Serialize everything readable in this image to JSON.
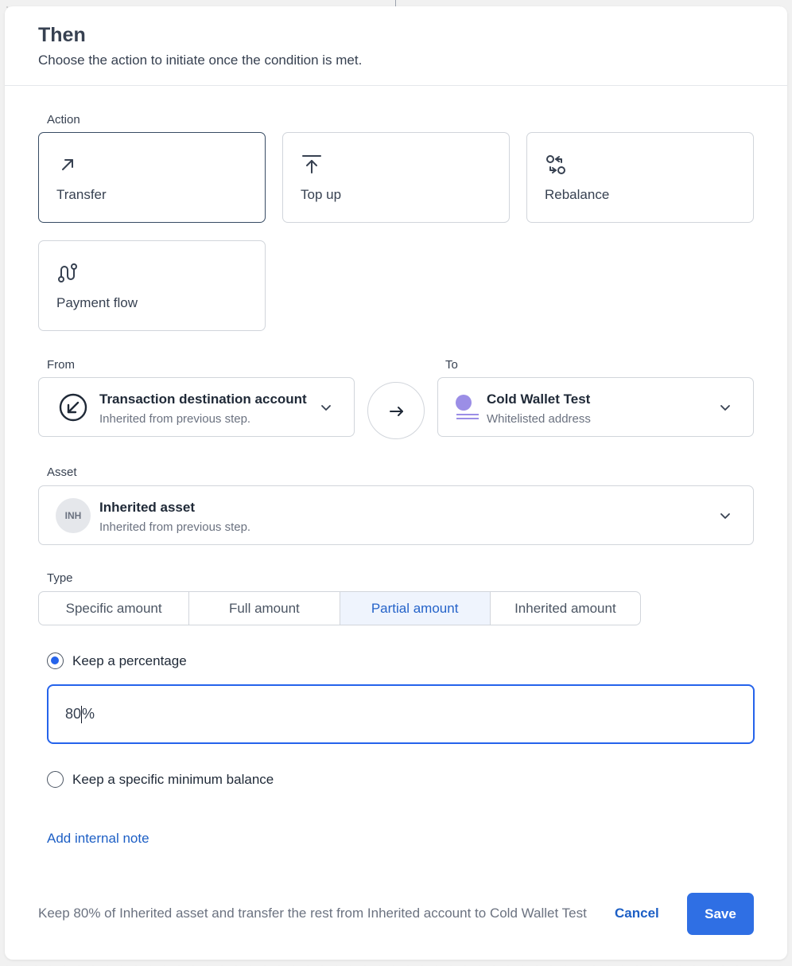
{
  "header": {
    "title": "Then",
    "subtitle": "Choose the action to initiate once the condition is met."
  },
  "action": {
    "label": "Action",
    "options": [
      {
        "label": "Transfer",
        "icon": "arrow-up-right-icon",
        "selected": true
      },
      {
        "label": "Top up",
        "icon": "arrow-up-to-line-icon",
        "selected": false
      },
      {
        "label": "Rebalance",
        "icon": "rebalance-icon",
        "selected": false
      },
      {
        "label": "Payment flow",
        "icon": "payment-flow-icon",
        "selected": false
      }
    ]
  },
  "from": {
    "label": "From",
    "title": "Transaction destination account",
    "subtitle": "Inherited from previous step."
  },
  "to": {
    "label": "To",
    "title": "Cold Wallet Test",
    "subtitle": "Whitelisted address",
    "icon_color": "#9b8ee6"
  },
  "asset": {
    "label": "Asset",
    "badge": "INH",
    "title": "Inherited asset",
    "subtitle": "Inherited from previous step."
  },
  "type": {
    "label": "Type",
    "options": [
      "Specific amount",
      "Full amount",
      "Partial amount",
      "Inherited amount"
    ],
    "selected": "Partial amount"
  },
  "partial": {
    "keep_percentage_label": "Keep a percentage",
    "percentage_before_caret": "80",
    "percentage_after_caret": "%",
    "keep_minimum_label": "Keep a specific minimum balance"
  },
  "note_link": "Add internal note",
  "footer": {
    "summary": "Keep 80% of Inherited asset and transfer the rest from Inherited account to Cold Wallet Test",
    "cancel_label": "Cancel",
    "save_label": "Save"
  },
  "colors": {
    "accent": "#2f6fe4",
    "link": "#1d5fc5",
    "selected_border": "#374b63"
  }
}
